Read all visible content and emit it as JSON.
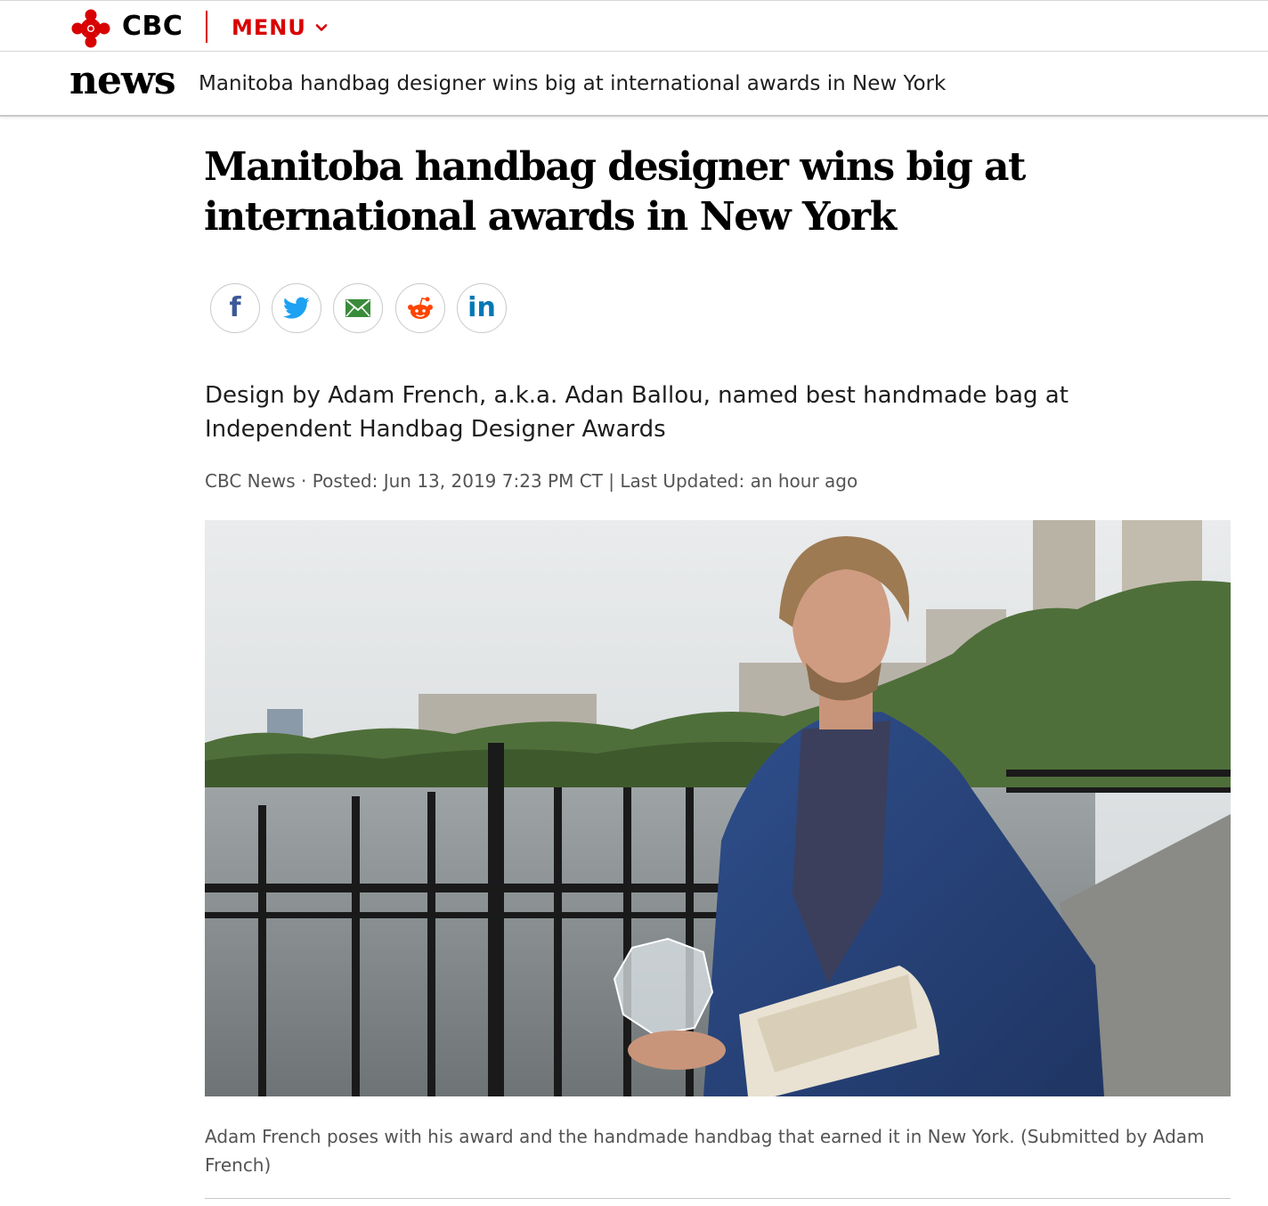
{
  "brand": {
    "name": "CBC",
    "red": "#d80000"
  },
  "menu": {
    "label": "MENU"
  },
  "section": {
    "name": "news"
  },
  "page_title": "Manitoba handbag designer wins big at international awards in New York",
  "article": {
    "headline": "Manitoba handbag designer wins big at international awards in New York",
    "dek": "Design by Adam French, a.k.a. Adan Ballou, named best handmade bag at Independent Handbag Designer Awards",
    "byline": {
      "source": "CBC News",
      "separator": " · ",
      "posted": "Posted: Jun 13, 2019 7:23 PM CT",
      "divider": " | ",
      "updated": "Last Updated: an hour ago"
    },
    "caption": "Adam French poses with his award and the handmade handbag that earned it in New York. (Submitted by Adam French)"
  },
  "share": [
    {
      "icon": "facebook-icon",
      "glyph": "f",
      "color": "#3b5998"
    },
    {
      "icon": "twitter-icon",
      "color": "#1da1f2"
    },
    {
      "icon": "email-icon",
      "color": "#3a8b3a"
    },
    {
      "icon": "reddit-icon",
      "color": "#ff4500"
    },
    {
      "icon": "linkedin-icon",
      "glyph": "in",
      "color": "#0077b5"
    }
  ]
}
